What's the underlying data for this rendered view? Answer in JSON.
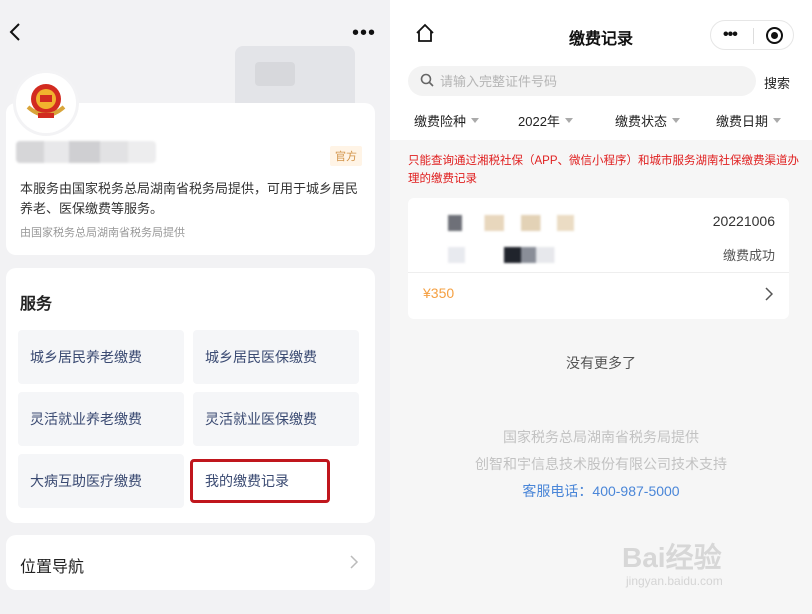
{
  "left": {
    "nav_more": "•••",
    "profile": {
      "badge": "官方",
      "description": "本服务由国家税务总局湖南省税务局提供，可用于城乡居民养老、医保缴费等服务。",
      "provider": "由国家税务总局湖南省税务局提供"
    },
    "services": {
      "title": "服务",
      "items": [
        {
          "label": "城乡居民养老缴费"
        },
        {
          "label": "城乡居民医保缴费"
        },
        {
          "label": "灵活就业养老缴费"
        },
        {
          "label": "灵活就业医保缴费"
        },
        {
          "label": "大病互助医疗缴费"
        },
        {
          "label": "我的缴费记录"
        }
      ]
    },
    "location_nav": {
      "label": "位置导航"
    }
  },
  "right": {
    "title": "缴费记录",
    "capsule_more": "•••",
    "search": {
      "placeholder": "请输入完整证件号码",
      "button": "搜索"
    },
    "filters": [
      {
        "label": "缴费险种"
      },
      {
        "label": "2022年"
      },
      {
        "label": "缴费状态"
      },
      {
        "label": "缴费日期"
      }
    ],
    "notice": "只能查询通过湘税社保（APP、微信小程序）和城市服务湖南社保缴费渠道办理的缴费记录",
    "record": {
      "date": "20221006",
      "status": "缴费成功",
      "amount": "¥350"
    },
    "no_more": "没有更多了",
    "footer": {
      "line1": "国家税务总局湖南省税务局提供",
      "line2": "创智和宇信息技术股份有限公司技术支持",
      "hotline": "客服电话：400-987-5000"
    },
    "watermark": "Bai经验",
    "watermark_sub": "jingyan.baidu.com"
  },
  "colors": {
    "highlight": "#c0161d",
    "amount": "#f5a042",
    "notice": "#e02020",
    "hotline": "#4a86d8"
  }
}
